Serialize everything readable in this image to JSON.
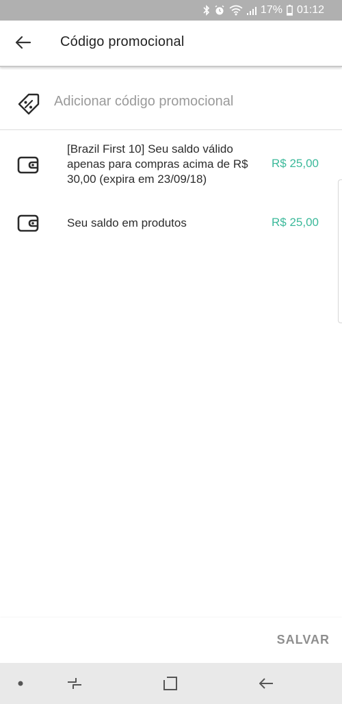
{
  "status_bar": {
    "battery_percent": "17%",
    "time": "01:12",
    "icons": [
      "bluetooth-icon",
      "alarm-icon",
      "wifi-icon",
      "signal-icon",
      "battery-icon"
    ]
  },
  "header": {
    "title": "Código promocional",
    "back_icon": "arrow-left-icon"
  },
  "promo": {
    "placeholder": "Adicionar código promocional",
    "icon": "discount-tag-icon"
  },
  "credits": [
    {
      "description": "[Brazil First 10] Seu saldo válido apenas para compras acima de R$ 30,00 (expira em 23/09/18)",
      "amount": "R$ 25,00",
      "icon": "wallet-icon"
    },
    {
      "description": "Seu saldo em produtos",
      "amount": "R$ 25,00",
      "icon": "wallet-icon"
    }
  ],
  "footer": {
    "save_label": "SALVAR"
  },
  "nav_bar": {
    "items": [
      "dot-icon",
      "recent-apps-icon",
      "home-icon",
      "back-icon"
    ]
  },
  "colors": {
    "accent": "#3bb99a",
    "status_bar": "#b0b0b0",
    "nav_bar": "#e9e9e9"
  }
}
